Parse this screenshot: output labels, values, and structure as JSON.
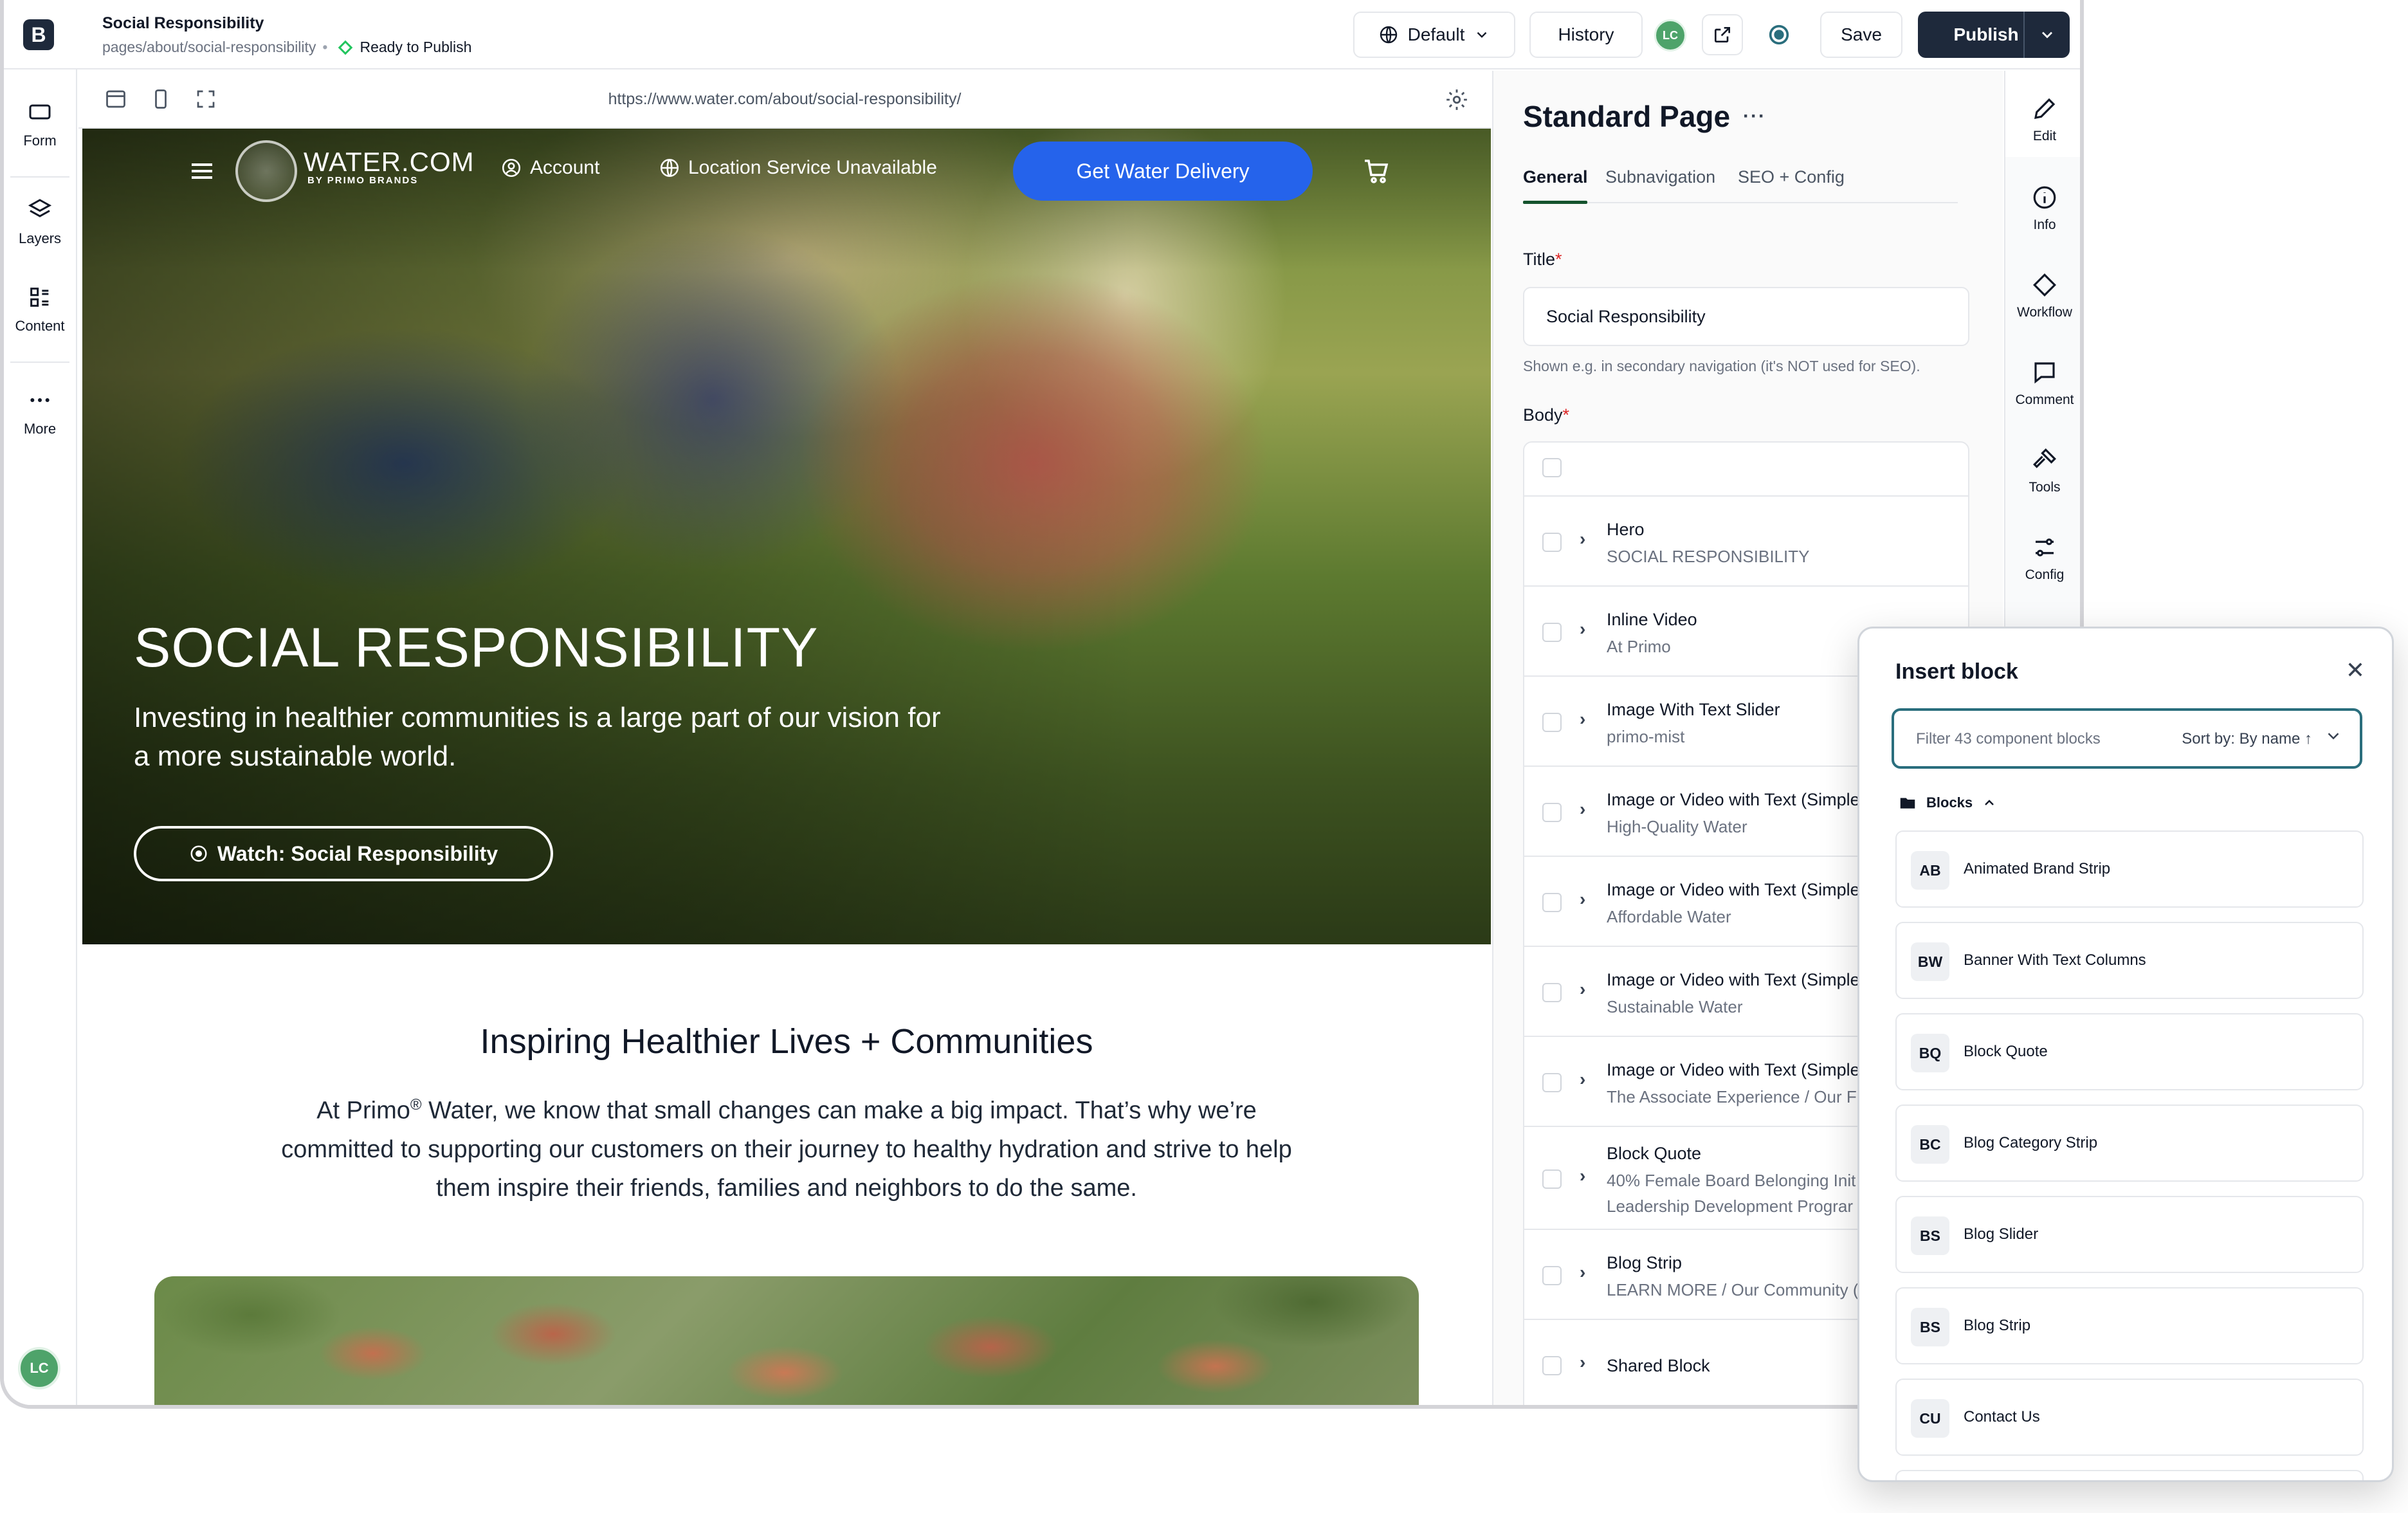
{
  "app": {
    "logo_letter": "B",
    "page_title": "Social Responsibility",
    "page_path": "pages/about/social-responsibility",
    "status": "Ready to Publish",
    "locale_label": "Default",
    "history_label": "History",
    "user_initials": "LC",
    "save_label": "Save",
    "publish_label": "Publish",
    "accent_color": "#1e293b"
  },
  "left_rail": {
    "items": [
      {
        "label": "Form",
        "icon": "form-icon"
      },
      {
        "label": "Layers",
        "icon": "layers-icon"
      },
      {
        "label": "Content",
        "icon": "content-icon"
      },
      {
        "label": "More",
        "icon": "more-icon"
      }
    ],
    "user_initials": "LC"
  },
  "preview": {
    "url": "https://www.water.com/about/social-responsibility/",
    "site": {
      "brand": "WATER.COM",
      "brand_sub": "BY PRIMO BRANDS",
      "account": "Account",
      "location": "Location Service Unavailable",
      "cta": "Get Water Delivery",
      "cta_color": "#2563eb"
    },
    "hero": {
      "title": "SOCIAL RESPONSIBILITY",
      "subtitle": "Investing in healthier communities is a large part of our vision for a more sustainable world.",
      "watch_label": "Watch: Social Responsibility"
    },
    "section": {
      "title": "Inspiring Healthier Lives + Communities",
      "body_prefix": "At Primo",
      "body_reg": "®",
      "body_rest": " Water, we know that small changes can make a big impact. That’s why we’re committed to supporting our customers on their journey to healthy hydration and strive to help them inspire their friends, families and neighbors to do the same."
    }
  },
  "editor": {
    "title": "Standard Page",
    "more": "···",
    "tabs": [
      "General",
      "Subnavigation",
      "SEO + Config"
    ],
    "title_label": "Title",
    "title_value": "Social Responsibility",
    "title_help": "Shown e.g. in secondary navigation (it's NOT used for SEO).",
    "body_label": "Body",
    "body_items": [
      {
        "title": "Hero",
        "subtitle": "SOCIAL RESPONSIBILITY"
      },
      {
        "title": "Inline Video",
        "subtitle": "At Primo"
      },
      {
        "title": "Image With Text Slider",
        "subtitle": "primo-mist"
      },
      {
        "title": "Image or Video with Text (Simple",
        "subtitle": "High-Quality Water"
      },
      {
        "title": "Image or Video with Text (Simple",
        "subtitle": "Affordable Water"
      },
      {
        "title": "Image or Video with Text (Simple",
        "subtitle": "Sustainable Water"
      },
      {
        "title": "Image or Video with Text (Simple",
        "subtitle": "The Associate Experience / Our F"
      },
      {
        "title": "Block Quote",
        "subtitle": "40% Female Board Belonging Init",
        "subtitle2": "Leadership Development Prograr"
      },
      {
        "title": "Blog Strip",
        "subtitle": "LEARN MORE / Our Community ("
      },
      {
        "title": "Shared Block",
        "subtitle": ""
      }
    ]
  },
  "action_rail": {
    "items": [
      {
        "label": "Edit",
        "icon": "pencil-icon"
      },
      {
        "label": "Info",
        "icon": "info-icon"
      },
      {
        "label": "Workflow",
        "icon": "diamond-icon"
      },
      {
        "label": "Comment",
        "icon": "comment-icon"
      },
      {
        "label": "Tools",
        "icon": "hammer-icon"
      },
      {
        "label": "Config",
        "icon": "sliders-icon"
      }
    ]
  },
  "insert_block": {
    "title": "Insert block",
    "filter_placeholder": "Filter 43 component blocks",
    "sort_label": "Sort by: By name ↑",
    "group_label": "Blocks",
    "blocks": [
      {
        "badge": "AB",
        "name": "Animated Brand Strip"
      },
      {
        "badge": "BW",
        "name": "Banner With Text Columns"
      },
      {
        "badge": "BQ",
        "name": "Block Quote"
      },
      {
        "badge": "BC",
        "name": "Blog Category Strip"
      },
      {
        "badge": "BS",
        "name": "Blog Slider"
      },
      {
        "badge": "BS",
        "name": "Blog Strip"
      },
      {
        "badge": "CU",
        "name": "Contact Us"
      }
    ]
  }
}
